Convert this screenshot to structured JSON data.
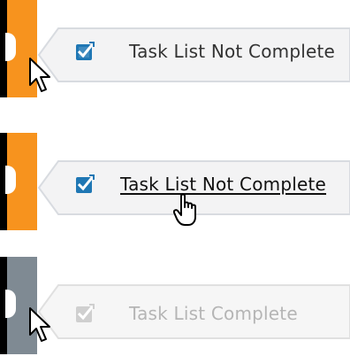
{
  "states": [
    {
      "id": "incomplete-hover",
      "label": "Task List Not Complete",
      "tab_color": "#f7931e",
      "text_color": "#333333",
      "icon": "checklist-icon",
      "icon_color": "#1f77b4",
      "cursor": "arrow-cursor"
    },
    {
      "id": "incomplete-link-hover",
      "label": "Task List Not Complete",
      "tab_color": "#f7931e",
      "text_color": "#111111",
      "icon": "checklist-icon",
      "icon_color": "#1f77b4",
      "cursor": "hand-cursor"
    },
    {
      "id": "complete",
      "label": "Task List Complete",
      "tab_color": "#7f8a93",
      "text_color": "#b5b5b5",
      "icon": "checklist-icon",
      "icon_color": "#cfcfcf",
      "cursor": "arrow-cursor"
    }
  ]
}
